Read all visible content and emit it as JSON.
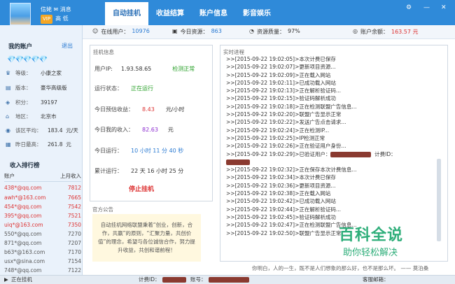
{
  "user": {
    "name": "信姥",
    "sub": "高 低",
    "vip": "VIP",
    "msg": "消息",
    "msg_icon": "mail-icon"
  },
  "tabs": [
    "自动挂机",
    "收益结算",
    "账户信息",
    "影音娱乐"
  ],
  "window": {
    "menu": "⚙",
    "min": "—",
    "close": "✕"
  },
  "account": {
    "title": "我的账户",
    "logout": "退出",
    "diamonds": "💎💎💎💎💎",
    "rows": [
      {
        "icon": "level-icon",
        "label": "等级：",
        "value": "小康之家"
      },
      {
        "icon": "version-icon",
        "label": "版本：",
        "value": "豪华高级版"
      },
      {
        "icon": "points-icon",
        "label": "积分：",
        "value": "39197"
      },
      {
        "icon": "region-icon",
        "label": "地区：",
        "value": "北京市"
      },
      {
        "icon": "avg-icon",
        "label": "该区平均：",
        "value": "183.4",
        "unit": "元/天"
      },
      {
        "icon": "yesterday-icon",
        "label": "昨日最高：",
        "value": "261.8",
        "unit": "元"
      }
    ]
  },
  "ranking": {
    "title": "收入排行榜",
    "col_account": "账户",
    "col_income": "上月收入",
    "rows": [
      {
        "account": "438*@qq.com",
        "income": "7812"
      },
      {
        "account": "awh*@163.com",
        "income": "7665"
      },
      {
        "account": "454*@qq.com",
        "income": "7542"
      },
      {
        "account": "395*@qq.com",
        "income": "7521"
      },
      {
        "account": "uiq*@163.com",
        "income": "7350"
      },
      {
        "account": "550*@qq.com",
        "income": "7270"
      },
      {
        "account": "871*@qq.com",
        "income": "7207"
      },
      {
        "account": "b63*@163.com",
        "income": "7170"
      },
      {
        "account": "usx*@sina.com",
        "income": "7154"
      },
      {
        "account": "748*@qq.com",
        "income": "7122"
      }
    ]
  },
  "stats": {
    "online_label": "在线用户：",
    "online": "10976",
    "today_label": "今日资源：",
    "today": "863",
    "quality_label": "资源质量：",
    "quality": "97%",
    "balance_label": "账户余额：",
    "balance": "163.57 元"
  },
  "hang": {
    "title": "挂机信息",
    "ip_label": "用户IP:",
    "ip": "1.93.58.65",
    "ip_status": "检测正常",
    "state_label": "运行状态：",
    "state": "正在运行",
    "expect_label": "今日预估收益：",
    "expect": "8.43",
    "expect_unit": "元/小时",
    "income_label": "今日我的收入：",
    "income": "82.63",
    "income_unit": "元",
    "run_label": "今日运行：",
    "run": "10 小时 11 分 40 秒",
    "total_label": "累计运行：",
    "total": "22 天 16 小时 25 分",
    "stop": "停止挂机"
  },
  "notice": {
    "title": "官方公告",
    "text": "自动挂机网络联盟秉着“创业，创新，合作，共赢”的原则，“汇聚力量，共创价值”的理念，希望与各位诚信合作，努力提升收益，共创和谐前程！"
  },
  "log": {
    "title": "实时进程",
    "lines": [
      ">>[2015-09-22 19:02:05]>本次计费已保存",
      ">>[2015-09-22 19:02:07]>更新项目资源...",
      ">>[2015-09-22 19:02:09]>正在载入网站",
      ">>[2015-09-22 19:02:11]>已成功载入网站",
      ">>[2015-09-22 19:02:13]>正在解析验证码...",
      ">>[2015-09-22 19:02:15]>验证码解析成功",
      ">>[2015-09-22 19:02:18]>正在检测联盟广告信息...",
      ">>[2015-09-22 19:02:20]>联盟广告显示正常",
      ">>[2015-09-22 19:02:22]>发送广告点击请求...",
      ">>[2015-09-22 19:02:24]>正在检测IP...",
      ">>[2015-09-22 19:02:25]>IP检测正常",
      ">>[2015-09-22 19:02:26]>正在验证用户身份...",
      ">>[2015-09-22 19:02:29]>已验证用户：",
      ">>[2015-09-22 19:02:32]>正在保存本次计费信息...",
      ">>[2015-09-22 19:02:34]>本次计费已保存",
      ">>[2015-09-22 19:02:36]>更新项目资源...",
      ">>[2015-09-22 19:02:38]>正在载入网站",
      ">>[2015-09-22 19:02:42]>已成功载入网站",
      ">>[2015-09-22 19:02:44]>正在解析验证码...",
      ">>[2015-09-22 19:02:45]>验证码解析成功",
      ">>[2015-09-22 19:02:47]>正在检测联盟广告信息...",
      ">>[2015-09-22 19:02:50]>联盟广告显示正常"
    ],
    "billing_label": "计费ID："
  },
  "quote": "你明白，人的一生，既不是人们想象的那么好，也不是那么坏。 —— 莫泊桑",
  "status": {
    "state": "正在挂机",
    "billing_label": "计费ID：",
    "account_label": "账号：",
    "service": "客服邮箱："
  },
  "watermark": {
    "big": "百科全说",
    "small": "助你轻松解决"
  }
}
